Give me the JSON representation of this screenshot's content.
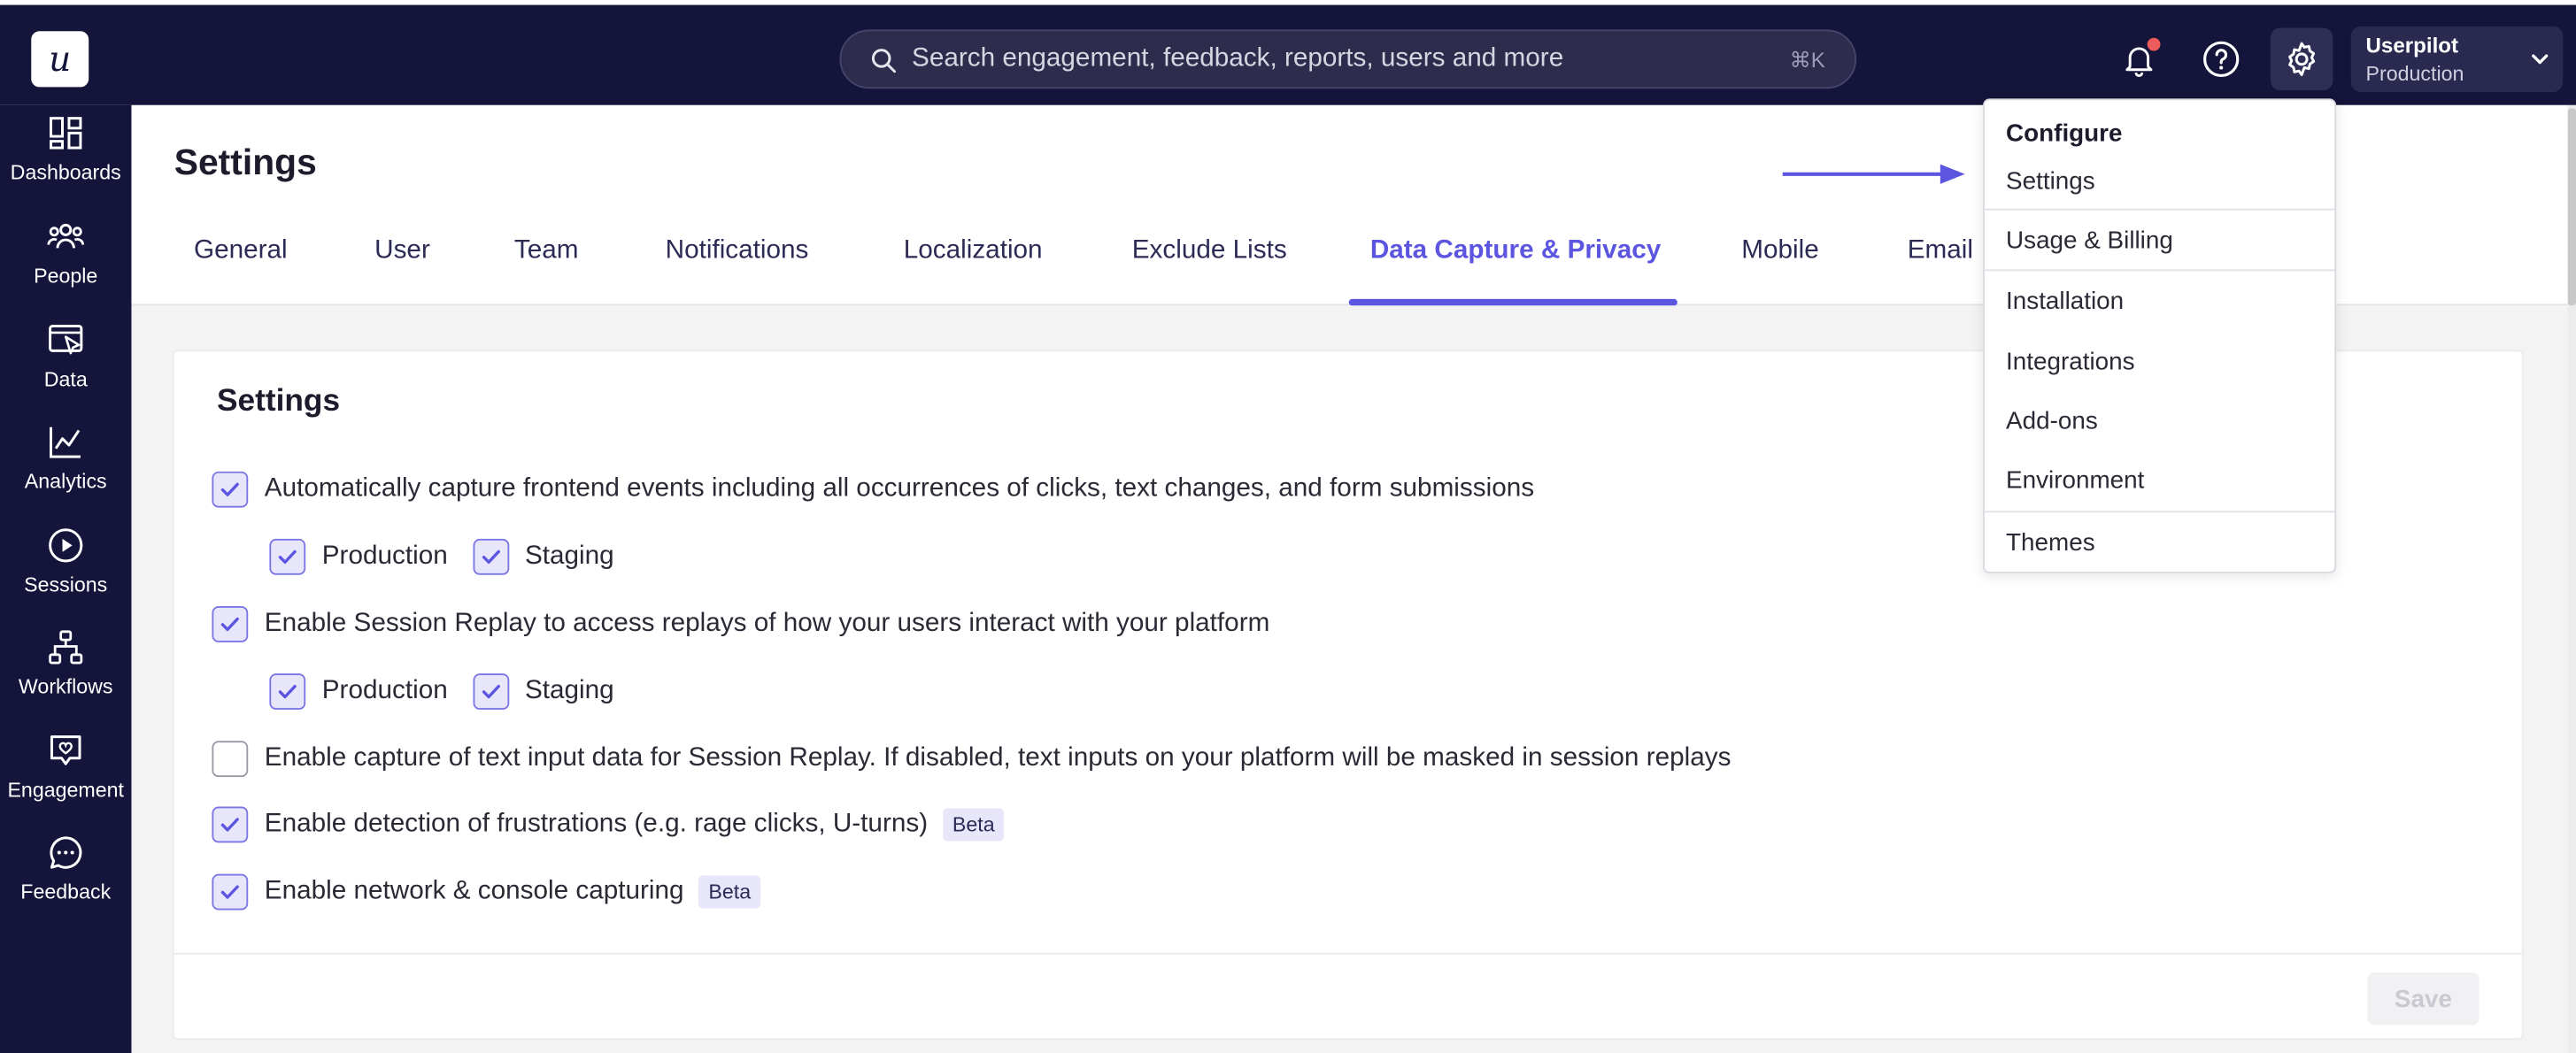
{
  "app": {
    "logo_letter": "u",
    "accent_color": "#5b55e0",
    "nav_bg": "#15143a"
  },
  "search": {
    "placeholder": "Search engagement, feedback, reports, users and more",
    "shortcut": "⌘K"
  },
  "account": {
    "name": "Userpilot",
    "environment": "Production"
  },
  "sidebar": {
    "items": [
      {
        "label": "Dashboards",
        "icon": "dashboards-icon"
      },
      {
        "label": "People",
        "icon": "people-icon"
      },
      {
        "label": "Data",
        "icon": "data-icon"
      },
      {
        "label": "Analytics",
        "icon": "analytics-icon"
      },
      {
        "label": "Sessions",
        "icon": "sessions-icon"
      },
      {
        "label": "Workflows",
        "icon": "workflows-icon"
      },
      {
        "label": "Engagement",
        "icon": "engagement-icon"
      },
      {
        "label": "Feedback",
        "icon": "feedback-icon"
      }
    ]
  },
  "header": {
    "title": "Settings",
    "tabs": [
      {
        "label": "General"
      },
      {
        "label": "User"
      },
      {
        "label": "Team"
      },
      {
        "label": "Notifications"
      },
      {
        "label": "Localization"
      },
      {
        "label": "Exclude Lists"
      },
      {
        "label": "Data Capture & Privacy",
        "active": true
      },
      {
        "label": "Mobile"
      },
      {
        "label": "Email"
      }
    ]
  },
  "card": {
    "title": "Settings",
    "options": [
      {
        "label": "Automatically capture frontend events including all occurrences of clicks, text changes, and form submissions",
        "checked": true,
        "sub": [
          {
            "label": "Production",
            "checked": true
          },
          {
            "label": "Staging",
            "checked": true
          }
        ]
      },
      {
        "label": "Enable Session Replay to access replays of how your users interact with your platform",
        "checked": true,
        "sub": [
          {
            "label": "Production",
            "checked": true
          },
          {
            "label": "Staging",
            "checked": true
          }
        ]
      },
      {
        "label": "Enable capture of text input data for Session Replay. If disabled, text inputs on your platform will be masked in session replays",
        "checked": false
      },
      {
        "label": "Enable detection of frustrations (e.g. rage clicks, U-turns)",
        "checked": true,
        "badge": "Beta"
      },
      {
        "label": "Enable network & console capturing",
        "checked": true,
        "badge": "Beta"
      }
    ],
    "save_label": "Save"
  },
  "menu": {
    "heading": "Configure",
    "items": [
      {
        "label": "Settings"
      },
      {
        "label": "Usage & Billing"
      },
      {
        "label": "Installation"
      },
      {
        "label": "Integrations"
      },
      {
        "label": "Add-ons"
      },
      {
        "label": "Environment"
      },
      {
        "label": "Themes"
      }
    ]
  }
}
